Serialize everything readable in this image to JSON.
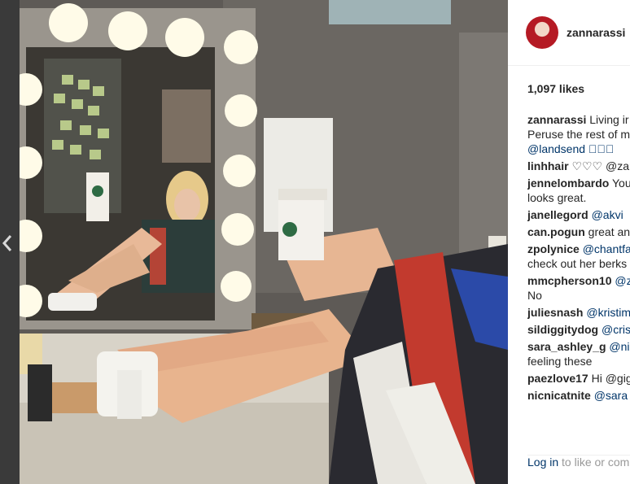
{
  "post": {
    "username": "zannarassi",
    "likes": "1,097 likes",
    "caption": {
      "user": "zannarassi",
      "lines": [
        "Living ir",
        "Peruse the rest of m",
        "@landsend ☀🏼🏝"
      ]
    },
    "comments": [
      {
        "user": "linhhair",
        "text": "♡♡♡ @zann"
      },
      {
        "user": "jennelombardo",
        "text": "You",
        "line2": "looks great."
      },
      {
        "user": "janellegord",
        "text": "@akvi"
      },
      {
        "user": "can.pogun",
        "text": "great an"
      },
      {
        "user": "zpolynice",
        "text": "@chantfa",
        "line2": "check out her berks"
      },
      {
        "user": "mmcpherson10",
        "text": "@z",
        "line2": "No"
      },
      {
        "user": "juliesnash",
        "text": "@kristim"
      },
      {
        "user": "sildiggitydog",
        "text": "@crisc"
      },
      {
        "user": "sara_ashley_g",
        "text": "@ni",
        "line2": "feeling these"
      },
      {
        "user": "paezlove17",
        "text": "Hi @gig"
      },
      {
        "user": "nicnicatnite",
        "text": "@sara"
      }
    ],
    "login": {
      "link": "Log in",
      "rest": "to like or com"
    }
  }
}
